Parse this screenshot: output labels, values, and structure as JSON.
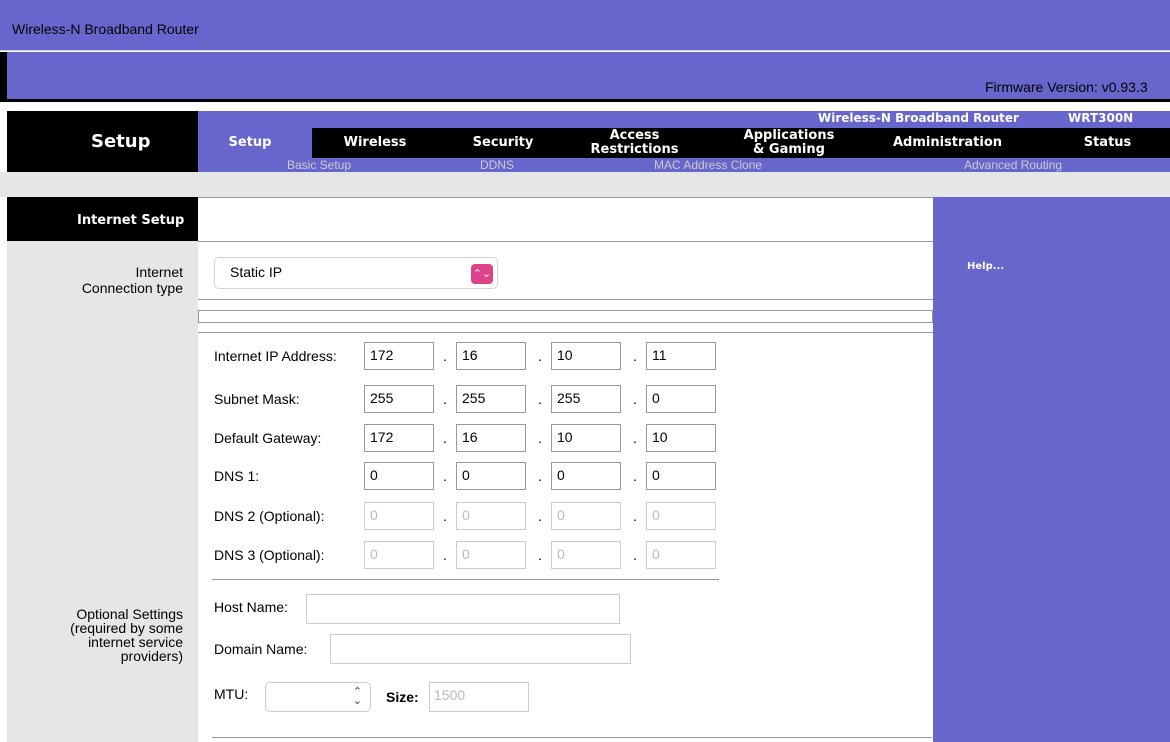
{
  "window": {
    "title": "Wireless-N Broadband Router"
  },
  "firmware": "Firmware Version: v0.93.3",
  "header": {
    "section": "Setup",
    "product_name": "Wireless-N Broadband Router",
    "model": "WRT300N"
  },
  "tabs": [
    {
      "label": "Setup",
      "active": true
    },
    {
      "label": "Wireless"
    },
    {
      "label": "Security"
    },
    {
      "label": "Access\nRestrictions"
    },
    {
      "label": "Applications\n& Gaming"
    },
    {
      "label": "Administration"
    },
    {
      "label": "Status"
    }
  ],
  "subtabs": [
    "Basic Setup",
    "DDNS",
    "MAC Address Clone",
    "Advanced Routing"
  ],
  "section_title": "Internet Setup",
  "help": "Help...",
  "connection": {
    "label": "Internet\nConnection type",
    "value": "Static IP"
  },
  "ip_fields": [
    {
      "label": "Internet IP Address:",
      "values": [
        "172",
        "16",
        "10",
        "11"
      ],
      "disabled": false
    },
    {
      "label": "Subnet Mask:",
      "values": [
        "255",
        "255",
        "255",
        "0"
      ],
      "disabled": false
    },
    {
      "label": "Default Gateway:",
      "values": [
        "172",
        "16",
        "10",
        "10"
      ],
      "disabled": false
    },
    {
      "label": "DNS 1:",
      "values": [
        "0",
        "0",
        "0",
        "0"
      ],
      "disabled": false
    },
    {
      "label": "DNS 2 (Optional):",
      "values": [
        "0",
        "0",
        "0",
        "0"
      ],
      "disabled": true
    },
    {
      "label": "DNS 3 (Optional):",
      "values": [
        "0",
        "0",
        "0",
        "0"
      ],
      "disabled": true
    }
  ],
  "optional": {
    "label": "Optional Settings\n(required by some\ninternet service\nproviders)",
    "host_name_label": "Host Name:",
    "host_name_value": "",
    "domain_name_label": "Domain Name:",
    "domain_name_value": "",
    "mtu_label": "MTU:",
    "mtu_value": "",
    "size_label": "Size:",
    "size_value": "1500"
  },
  "colors": {
    "brand_purple": "#6666cc",
    "nav_black": "#000000",
    "select_accent": "#e0428a"
  }
}
